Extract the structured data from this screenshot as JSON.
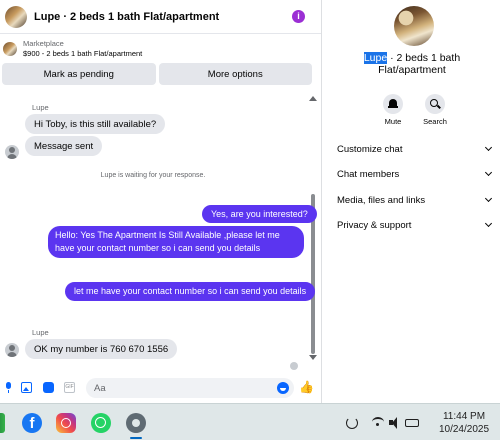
{
  "chat": {
    "header_title": "Lupe · 2 beds 1 bath Flat/apartment",
    "info_icon": "i",
    "marketplace": {
      "label": "Marketplace",
      "listing": "$900 - 2 beds 1 bath Flat/apartment"
    },
    "actions": {
      "mark_pending": "Mark as pending",
      "more_options": "More options"
    },
    "messages": {
      "sender_1": "Lupe",
      "msg_1": "Hi Toby, is this still available?",
      "msg_2": "Message sent",
      "waiting": "Lupe is waiting for your response.",
      "out_1": "Yes, are you interested?",
      "out_2": "Hello: Yes The Apartment Is Still Available ,please let me have your contact number so i can send you details",
      "out_3": "let me have your contact number so i can send you details",
      "sender_2": "Lupe",
      "msg_3": "OK my number is 760 670 1556"
    },
    "composer": {
      "placeholder": "Aa",
      "gif_label": "GIF",
      "like_icon": "👍"
    }
  },
  "info_panel": {
    "name_highlight": "Lupe",
    "name_rest": " · 2 beds 1 bath Flat/apartment",
    "mute_label": "Mute",
    "search_label": "Search",
    "menu": [
      "Customize chat",
      "Chat members",
      "Media, files and links",
      "Privacy & support"
    ]
  },
  "taskbar": {
    "facebook_glyph": "f",
    "time": "11:44 PM",
    "date": "10/24/2025"
  },
  "colors": {
    "outgoing_bubble": "#5b35f0",
    "incoming_bubble": "#e4e6eb",
    "accent": "#0866ff"
  }
}
